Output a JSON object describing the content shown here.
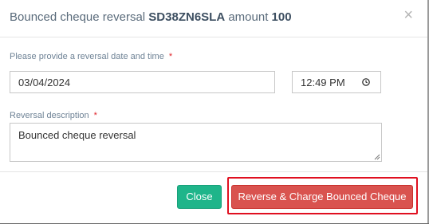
{
  "modal": {
    "title_prefix": "Bounced cheque reversal",
    "cheque_id": "SD38ZN6SLA",
    "amount_label": "amount",
    "amount_value": "100",
    "close_symbol": "×"
  },
  "form": {
    "date_label": "Please provide a reversal date and time",
    "required_mark": "*",
    "date_value": "03/04/2024",
    "time_value": "12:49 PM",
    "description_label": "Reversal description",
    "description_value": "Bounced cheque reversal"
  },
  "footer": {
    "close_label": "Close",
    "reverse_label": "Reverse & Charge Bounced Cheque"
  },
  "colors": {
    "close_button": "#1fb58a",
    "reverse_button": "#d9534f",
    "highlight_border": "#e01020",
    "required_mark": "#e0242b"
  },
  "icons": {
    "close": "close-icon",
    "clock": "clock-icon",
    "resize": "resize-grip-icon"
  }
}
